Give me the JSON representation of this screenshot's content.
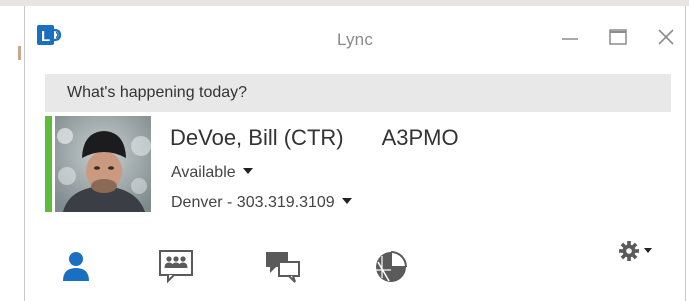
{
  "window": {
    "title": "Lync"
  },
  "whats_happening": {
    "placeholder": "What's happening today?"
  },
  "contact": {
    "name": "DeVoe, Bill  (CTR)",
    "department": "A3PMO",
    "status": "Available",
    "location": "Denver - 303.319.3109",
    "presence_color": "#5bbd3a"
  },
  "nav": {
    "items": [
      {
        "name": "contacts",
        "icon": "person-icon",
        "active": true
      },
      {
        "name": "groups",
        "icon": "group-icon",
        "active": false
      },
      {
        "name": "conversations",
        "icon": "conversations-icon",
        "active": false
      },
      {
        "name": "meetings",
        "icon": "meetings-icon",
        "active": false
      }
    ]
  },
  "settings": {
    "icon": "gear-icon"
  },
  "colors": {
    "accent": "#1b6fc0",
    "icon_gray": "#5a5a5a",
    "presence_available": "#5bbd3a"
  }
}
